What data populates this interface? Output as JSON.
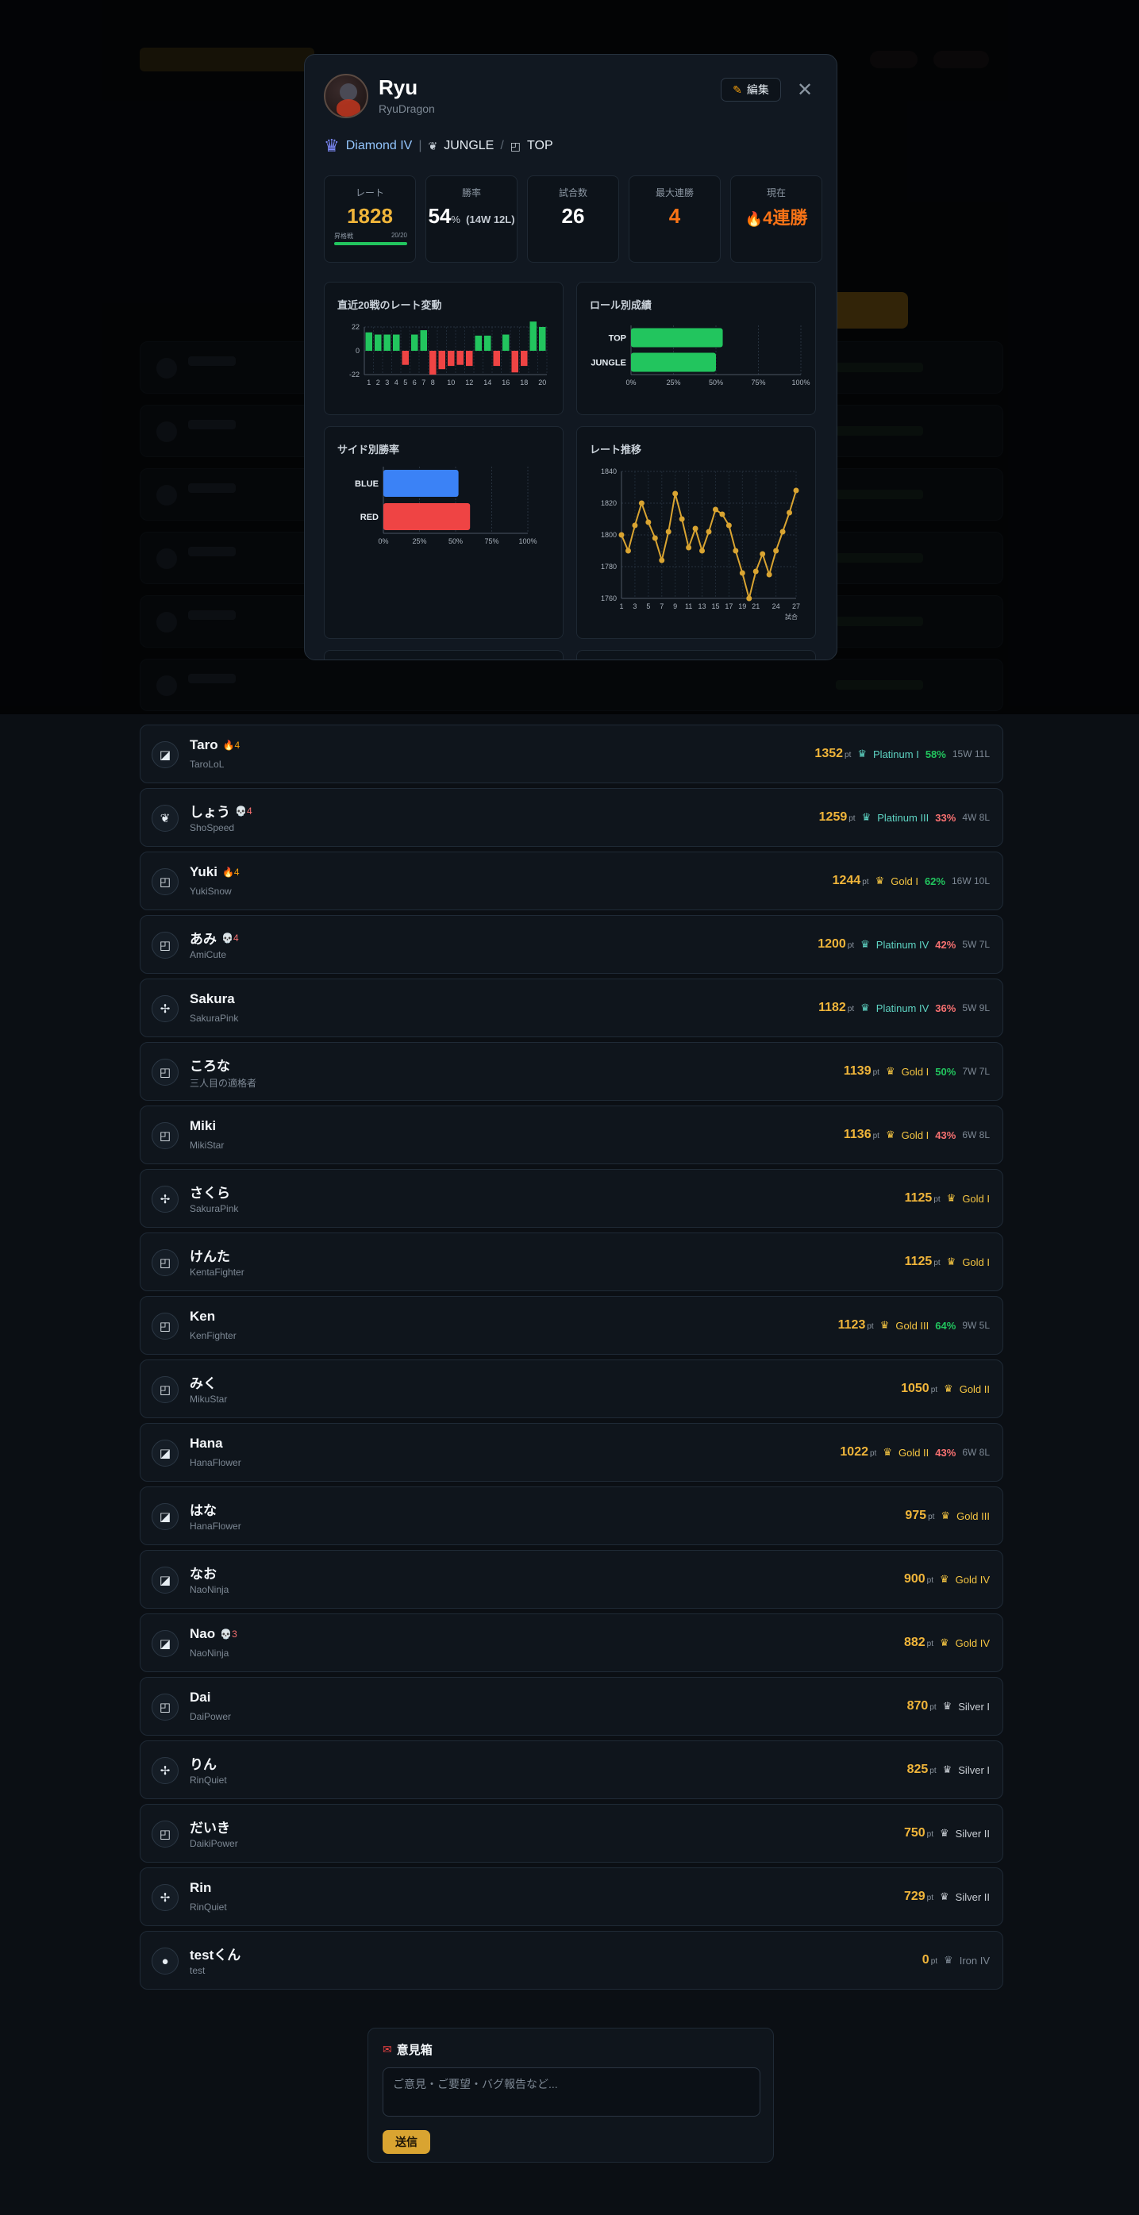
{
  "profile": {
    "name": "Ryu",
    "handle": "RyuDragon",
    "edit_label": "編集",
    "close_glyph": "✕",
    "tier": "Diamond IV",
    "role_separator": "|",
    "main_role": "JUNGLE",
    "slash": "/",
    "sub_role": "TOP"
  },
  "stats": {
    "rate_label": "レート",
    "rate_value": "1828",
    "progress_label": "昇格戦 ",
    "progress_value": "20/20",
    "progress_fraction": 1.0,
    "winrate_label": "勝率",
    "winrate_value": "54",
    "winrate_pct": "%",
    "winrate_record": "(14W 12L)",
    "games_label": "試合数",
    "games_value": "26",
    "maxstreak_label": "最大連勝",
    "maxstreak_value": "4",
    "current_label": "現在",
    "current_value": "4連勝"
  },
  "charts_titles": {
    "rate_change": "直近20戦のレート変動",
    "role_results": "ロール別成績",
    "side_winrate": "サイド別勝率",
    "rate_trend": "レート推移"
  },
  "chart_data": [
    {
      "type": "bar",
      "title": "直近20戦のレート変動",
      "categories": [
        "1",
        "2",
        "3",
        "4",
        "5",
        "6",
        "7",
        "8",
        "9",
        "10",
        "11",
        "12",
        "13",
        "14",
        "15",
        "16",
        "17",
        "18",
        "19",
        "20"
      ],
      "values": [
        17,
        15,
        15,
        15,
        -13,
        15,
        19,
        -22,
        -17,
        -14,
        -13,
        -14,
        14,
        14,
        -14,
        15,
        -20,
        -14,
        27,
        22
      ],
      "ytick_labels": [
        "22",
        "0",
        "-22"
      ],
      "xtick_labels": [
        "1",
        "2",
        "3",
        "4",
        "5",
        "6",
        "7",
        "8",
        "10",
        "12",
        "14",
        "16",
        "18",
        "20"
      ],
      "ylim": [
        -22,
        22
      ]
    },
    {
      "type": "bar",
      "orientation": "horizontal",
      "title": "ロール別成績",
      "categories": [
        "TOP",
        "JUNGLE"
      ],
      "values": [
        54,
        50
      ],
      "xtick_labels": [
        "0%",
        "25%",
        "50%",
        "75%",
        "100%"
      ],
      "xlim": [
        0,
        100
      ]
    },
    {
      "type": "bar",
      "orientation": "horizontal",
      "title": "サイド別勝率",
      "categories": [
        "BLUE",
        "RED"
      ],
      "values": [
        52,
        60
      ],
      "colors": [
        "#3b82f6",
        "#ef4444"
      ],
      "xtick_labels": [
        "0%",
        "25%",
        "50%",
        "75%",
        "100%"
      ],
      "xlim": [
        0,
        100
      ]
    },
    {
      "type": "line",
      "title": "レート推移",
      "x": [
        1,
        2,
        3,
        4,
        5,
        6,
        7,
        8,
        9,
        10,
        11,
        12,
        13,
        14,
        15,
        16,
        17,
        18,
        19,
        20,
        21,
        22,
        23,
        24,
        25,
        26,
        27
      ],
      "values": [
        1800,
        1790,
        1806,
        1820,
        1808,
        1798,
        1784,
        1802,
        1826,
        1810,
        1792,
        1804,
        1790,
        1802,
        1816,
        1813,
        1806,
        1790,
        1776,
        1760,
        1777,
        1788,
        1775,
        1790,
        1802,
        1814,
        1828
      ],
      "ytick_labels": [
        "1840",
        "1820",
        "1800",
        "1780",
        "1760"
      ],
      "xtick_labels": [
        "1",
        "3",
        "5",
        "7",
        "9",
        "11",
        "13",
        "15",
        "17",
        "19",
        "21",
        "24",
        "27"
      ],
      "xlabel": "試合",
      "ylim": [
        1760,
        1840
      ]
    }
  ],
  "players": [
    {
      "name": "Taro",
      "streak_icon": "🔥",
      "streak": "4",
      "streak_type": "win",
      "handle": "TaroLoL",
      "icon": "◪",
      "pt": "1352",
      "tier": "Platinum I",
      "wr": "58%",
      "rec": "15W 11L"
    },
    {
      "name": "しょう",
      "streak_icon": "💀",
      "streak": "4",
      "streak_type": "lose",
      "handle": "ShoSpeed",
      "icon": "❦",
      "pt": "1259",
      "tier": "Platinum III",
      "wr": "33%",
      "rec": "4W 8L"
    },
    {
      "name": "Yuki",
      "streak_icon": "🔥",
      "streak": "4",
      "streak_type": "win",
      "handle": "YukiSnow",
      "icon": "◰",
      "pt": "1244",
      "tier": "Gold I",
      "wr": "62%",
      "rec": "16W 10L"
    },
    {
      "name": "あみ",
      "streak_icon": "💀",
      "streak": "4",
      "streak_type": "lose",
      "handle": "AmiCute",
      "icon": "◰",
      "pt": "1200",
      "tier": "Platinum IV",
      "wr": "42%",
      "rec": "5W 7L"
    },
    {
      "name": "Sakura",
      "streak_icon": "",
      "streak": "",
      "streak_type": "",
      "handle": "SakuraPink",
      "icon": "✢",
      "pt": "1182",
      "tier": "Platinum IV",
      "wr": "36%",
      "rec": "5W 9L"
    },
    {
      "name": "ころな",
      "streak_icon": "",
      "streak": "",
      "streak_type": "",
      "handle": "三人目の適格者",
      "icon": "◰",
      "pt": "1139",
      "tier": "Gold I",
      "wr": "50%",
      "rec": "7W 7L"
    },
    {
      "name": "Miki",
      "streak_icon": "",
      "streak": "",
      "streak_type": "",
      "handle": "MikiStar",
      "icon": "◰",
      "pt": "1136",
      "tier": "Gold I",
      "wr": "43%",
      "rec": "6W 8L"
    },
    {
      "name": "さくら",
      "streak_icon": "",
      "streak": "",
      "streak_type": "",
      "handle": "SakuraPink",
      "icon": "✢",
      "pt": "1125",
      "tier": "Gold I",
      "wr": "",
      "rec": ""
    },
    {
      "name": "けんた",
      "streak_icon": "",
      "streak": "",
      "streak_type": "",
      "handle": "KentaFighter",
      "icon": "◰",
      "pt": "1125",
      "tier": "Gold I",
      "wr": "",
      "rec": ""
    },
    {
      "name": "Ken",
      "streak_icon": "",
      "streak": "",
      "streak_type": "",
      "handle": "KenFighter",
      "icon": "◰",
      "pt": "1123",
      "tier": "Gold III",
      "wr": "64%",
      "rec": "9W 5L"
    },
    {
      "name": "みく",
      "streak_icon": "",
      "streak": "",
      "streak_type": "",
      "handle": "MikuStar",
      "icon": "◰",
      "pt": "1050",
      "tier": "Gold II",
      "wr": "",
      "rec": ""
    },
    {
      "name": "Hana",
      "streak_icon": "",
      "streak": "",
      "streak_type": "",
      "handle": "HanaFlower",
      "icon": "◪",
      "pt": "1022",
      "tier": "Gold II",
      "wr": "43%",
      "rec": "6W 8L"
    },
    {
      "name": "はな",
      "streak_icon": "",
      "streak": "",
      "streak_type": "",
      "handle": "HanaFlower",
      "icon": "◪",
      "pt": "975",
      "tier": "Gold III",
      "wr": "",
      "rec": ""
    },
    {
      "name": "なお",
      "streak_icon": "",
      "streak": "",
      "streak_type": "",
      "handle": "NaoNinja",
      "icon": "◪",
      "pt": "900",
      "tier": "Gold IV",
      "wr": "",
      "rec": ""
    },
    {
      "name": "Nao",
      "streak_icon": "💀",
      "streak": "3",
      "streak_type": "lose",
      "handle": "NaoNinja",
      "icon": "◪",
      "pt": "882",
      "tier": "Gold IV",
      "wr": "",
      "rec": ""
    },
    {
      "name": "Dai",
      "streak_icon": "",
      "streak": "",
      "streak_type": "",
      "handle": "DaiPower",
      "icon": "◰",
      "pt": "870",
      "tier": "Silver I",
      "wr": "",
      "rec": ""
    },
    {
      "name": "りん",
      "streak_icon": "",
      "streak": "",
      "streak_type": "",
      "handle": "RinQuiet",
      "icon": "✢",
      "pt": "825",
      "tier": "Silver I",
      "wr": "",
      "rec": ""
    },
    {
      "name": "だいき",
      "streak_icon": "",
      "streak": "",
      "streak_type": "",
      "handle": "DaikiPower",
      "icon": "◰",
      "pt": "750",
      "tier": "Silver II",
      "wr": "",
      "rec": ""
    },
    {
      "name": "Rin",
      "streak_icon": "",
      "streak": "",
      "streak_type": "",
      "handle": "RinQuiet",
      "icon": "✢",
      "pt": "729",
      "tier": "Silver II",
      "wr": "",
      "rec": ""
    },
    {
      "name": "testくん",
      "streak_icon": "",
      "streak": "",
      "streak_type": "",
      "handle": "test",
      "icon": "●",
      "pt": "0",
      "tier": "Iron IV",
      "wr": "",
      "rec": ""
    }
  ],
  "pt_unit": "pt",
  "colors": {
    "gold_tier": "#f5c542",
    "platinum_tier": "#5ed4c3",
    "silver_tier": "#c8cdd3",
    "iron_tier": "#7d8894",
    "win": "#22c55e",
    "lose": "#f87171",
    "neutral_wr": "#22c55e"
  },
  "feedback": {
    "title": "意見箱",
    "placeholder": "ご意見・ご要望・バグ報告など...",
    "submit_label": "送信"
  }
}
